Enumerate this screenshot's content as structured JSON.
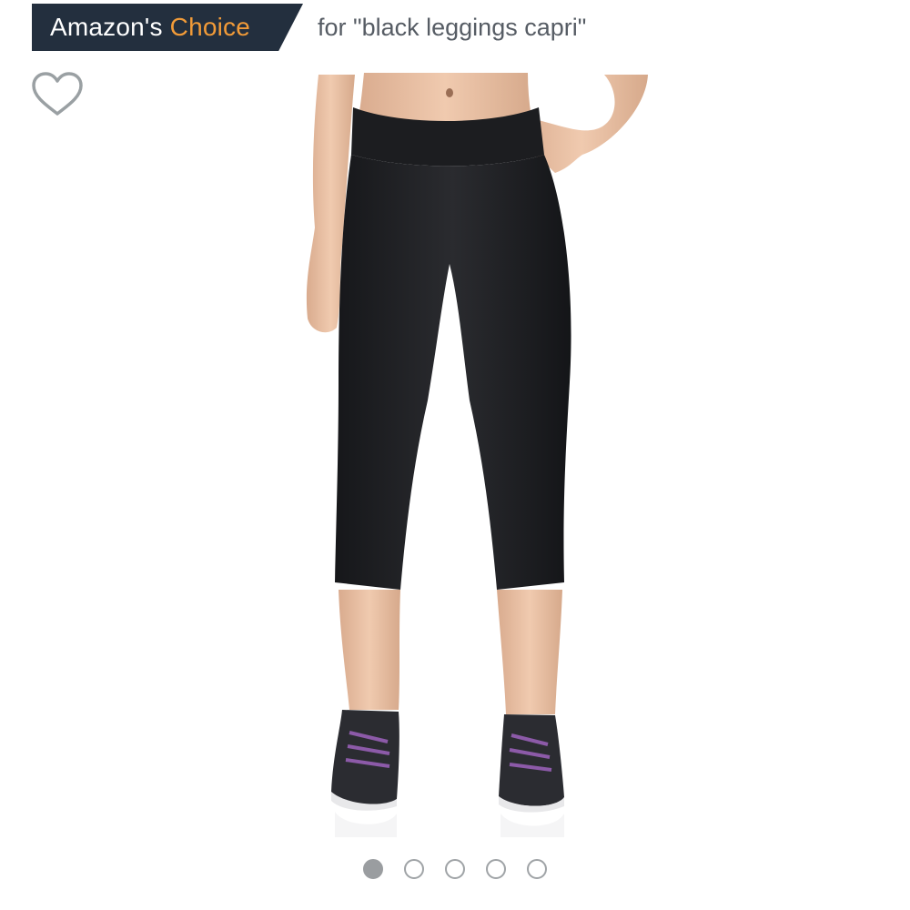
{
  "badge": {
    "brand_text": "Amazon's ",
    "choice_text": "Choice",
    "query_text": "for \"black leggings capri\"",
    "colors": {
      "background": "#232f3e",
      "brand": "#ffffff",
      "choice": "#f29b38",
      "query": "#565c64"
    }
  },
  "wishlist": {
    "icon": "heart-outline-icon",
    "color": "#9aa0a3"
  },
  "product_image": {
    "subject": "black capri leggings with athletic sneakers"
  },
  "carousel": {
    "total": 5,
    "active_index": 0
  }
}
